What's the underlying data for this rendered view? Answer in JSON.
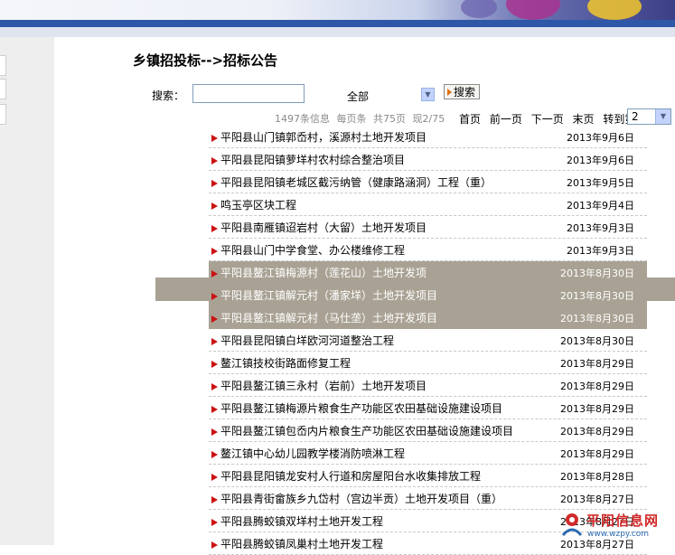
{
  "page": {
    "title": "乡镇招投标-->招标公告"
  },
  "search": {
    "label": "搜索：",
    "input_value": "",
    "category_selected": "全部",
    "button_label": "搜索"
  },
  "pager": {
    "total_info": "1497条信息",
    "per_page": "每页条",
    "total_pages": "共75页",
    "current": "现2/75",
    "first": "首页",
    "prev": "前一页",
    "next": "下一页",
    "last": "末页",
    "goto": "转到第",
    "goto_value": "2"
  },
  "announcements": [
    {
      "title": "平阳县山门镇郭岙村，溪源村土地开发项目",
      "date": "2013年9月6日",
      "highlighted": false
    },
    {
      "title": "平阳县昆阳镇萝垟村农村综合整治项目",
      "date": "2013年9月6日",
      "highlighted": false
    },
    {
      "title": "平阳县昆阳镇老城区截污纳管（健康路涵洞）工程（重）",
      "date": "2013年9月5日",
      "highlighted": false
    },
    {
      "title": "鸣玉亭区块工程",
      "date": "2013年9月4日",
      "highlighted": false
    },
    {
      "title": " 平阳县南雁镇迢岩村（大留）土地开发项目",
      "date": "2013年9月3日",
      "highlighted": false
    },
    {
      "title": "平阳县山门中学食堂、办公楼维修工程",
      "date": "2013年9月3日",
      "highlighted": false
    },
    {
      "title": "平阳县鳌江镇梅源村（莲花山）土地开发项",
      "date": "2013年8月30日",
      "highlighted": true
    },
    {
      "title": "平阳县鳌江镇解元村（潘家垟）土地开发项目",
      "date": "2013年8月30日",
      "highlighted": true
    },
    {
      "title": "平阳县鳌江镇解元村（马仕垄）土地开发项目",
      "date": "2013年8月30日",
      "highlighted": true
    },
    {
      "title": "平阳县昆阳镇白垟欧河河道整治工程",
      "date": "2013年8月30日",
      "highlighted": false
    },
    {
      "title": "鳌江镇技校街路面修复工程",
      "date": "2013年8月29日",
      "highlighted": false
    },
    {
      "title": "平阳县鳌江镇三永村（岩前）土地开发项目",
      "date": "2013年8月29日",
      "highlighted": false
    },
    {
      "title": "平阳县鳌江镇梅源片粮食生产功能区农田基础设施建设项目",
      "date": "2013年8月29日",
      "highlighted": false
    },
    {
      "title": "平阳县鳌江镇包岙内片粮食生产功能区农田基础设施建设项目",
      "date": "2013年8月29日",
      "highlighted": false
    },
    {
      "title": "鳌江镇中心幼儿园教学楼消防喷淋工程",
      "date": "2013年8月29日",
      "highlighted": false
    },
    {
      "title": "平阳县昆阳镇龙安村人行道和房屋阳台水收集排放工程",
      "date": "2013年8月28日",
      "highlighted": false
    },
    {
      "title": "平阳县青街畲族乡九岱村（宫边半贡）土地开发项目（重）",
      "date": "2013年8月27日",
      "highlighted": false
    },
    {
      "title": "平阳县腾蛟镇双垟村土地开发工程",
      "date": "2013年8月27日",
      "highlighted": false
    },
    {
      "title": "平阳县腾蛟镇凤巢村土地开发工程",
      "date": "2013年8月27日",
      "highlighted": false
    }
  ],
  "logo": {
    "name": "平阳信息网",
    "url": "www.wzpy.com"
  },
  "colors": {
    "banner_blue": "#2e57a7",
    "bullet_red": "#cc1111",
    "highlight": "#a9a294"
  },
  "icons": {
    "bullet": "red-triangle-arrow",
    "search_button": "orange-triangle-arrow"
  }
}
